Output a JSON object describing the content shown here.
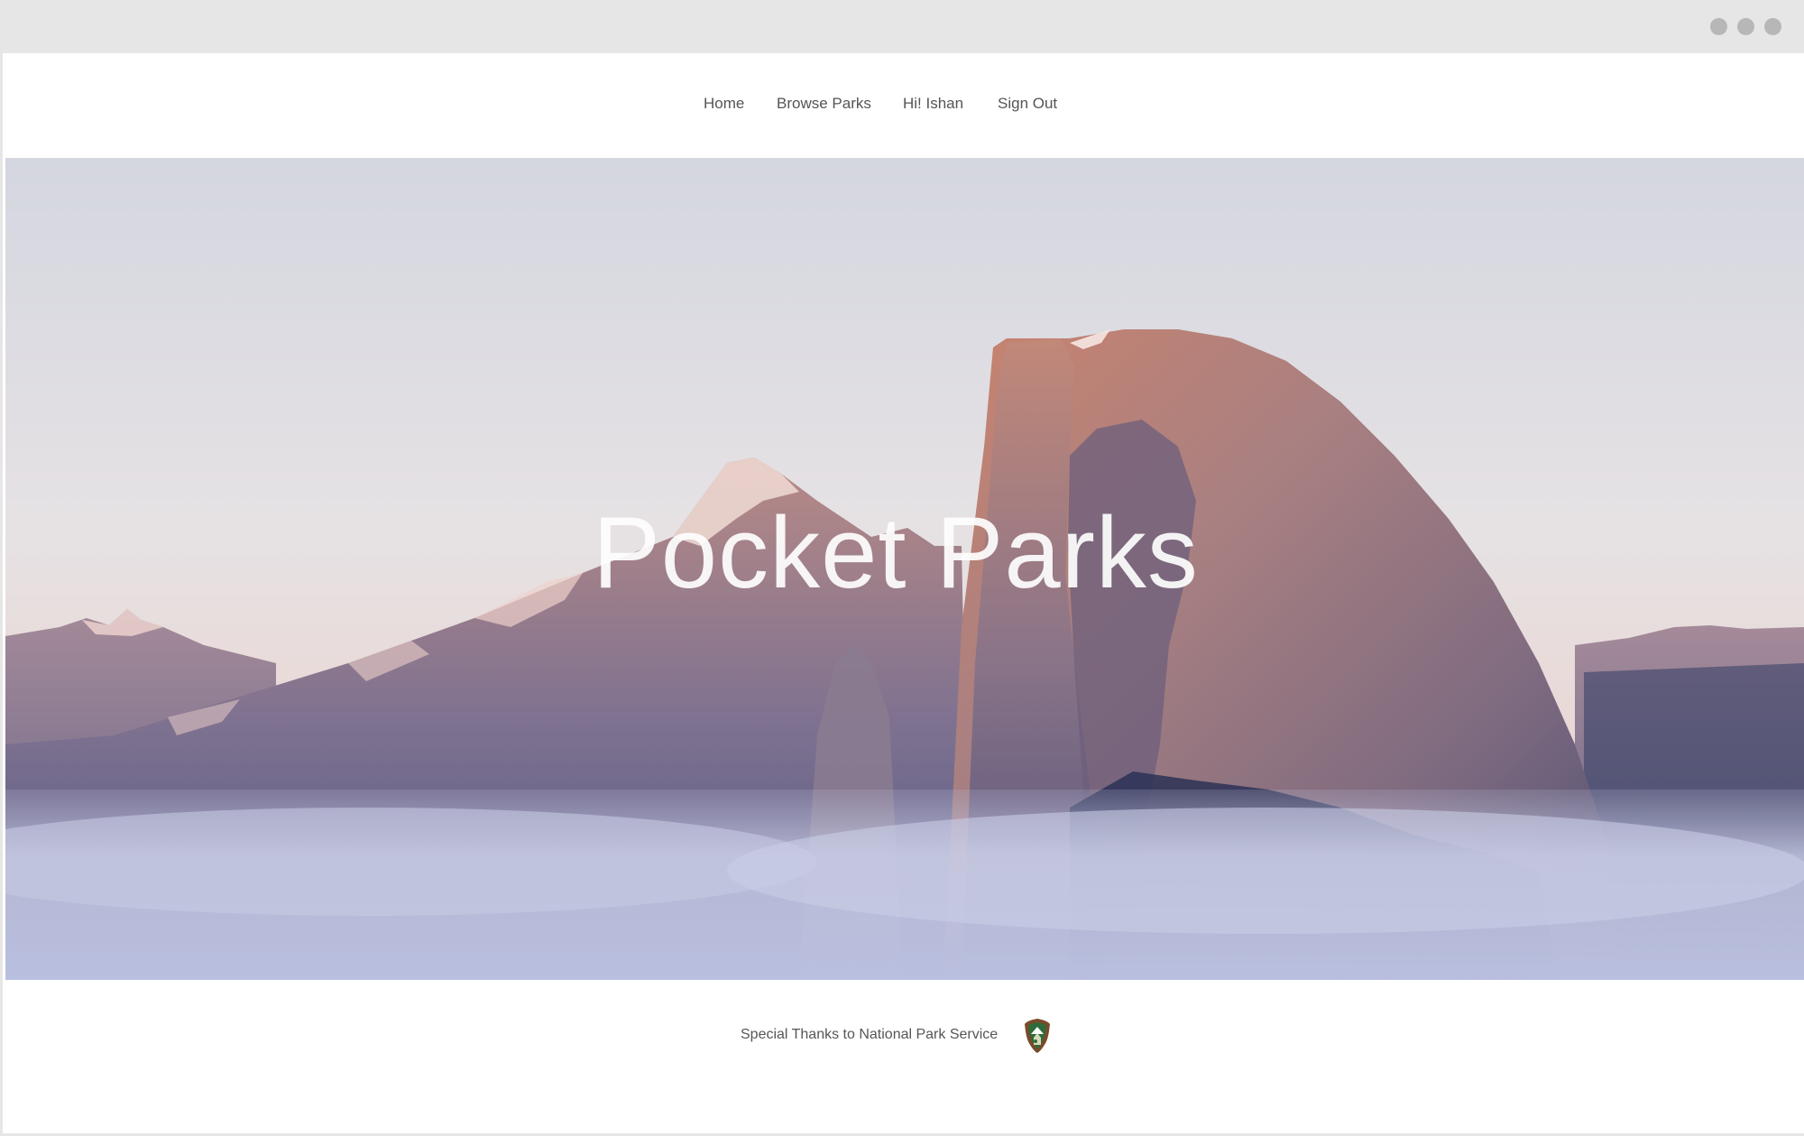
{
  "nav": {
    "items": [
      {
        "label": "Home"
      },
      {
        "label": "Browse Parks"
      },
      {
        "label": "Hi! Ishan"
      },
      {
        "label": "Sign Out"
      }
    ]
  },
  "hero": {
    "title": "Pocket Parks"
  },
  "footer": {
    "credit": "Special Thanks to National Park Service",
    "logo_icon": "nps-arrowhead-icon"
  },
  "colors": {
    "titlebar": "#e6e6e6",
    "nav_text": "#555555",
    "sky_top": "#d9dbe4",
    "rock_glow": "#c98a7a",
    "fog": "#c9cde3"
  }
}
